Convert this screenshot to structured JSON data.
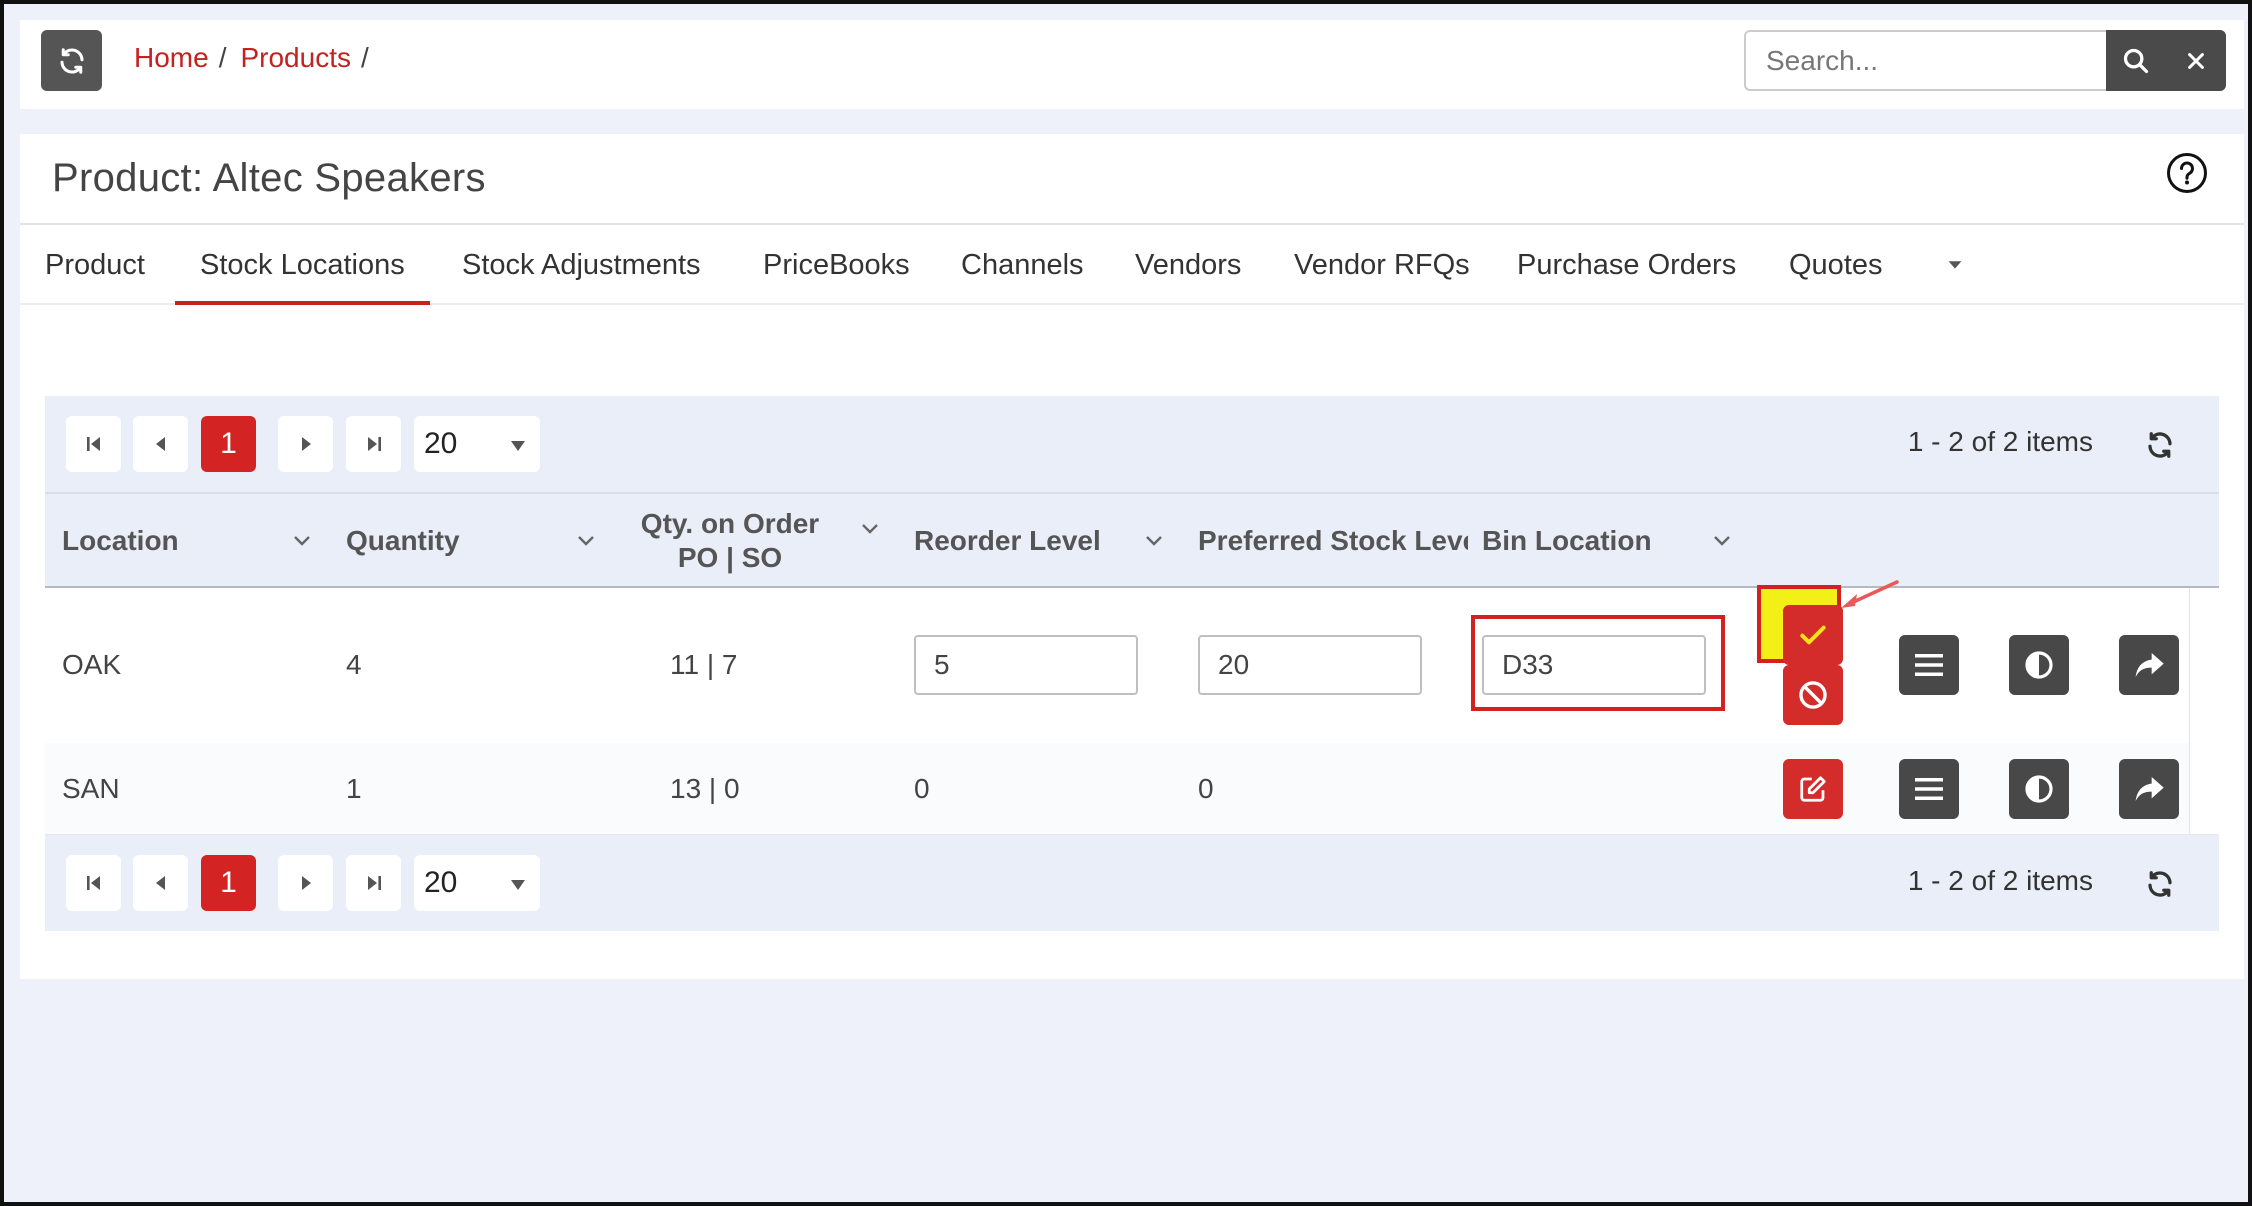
{
  "topbar": {
    "breadcrumb": {
      "home": "Home",
      "products": "Products",
      "sep1": "/",
      "sep2": "/"
    },
    "search": {
      "placeholder": "Search...",
      "value": ""
    }
  },
  "page": {
    "title": "Product: Altec Speakers"
  },
  "tabs": [
    {
      "label": "Product",
      "active": false
    },
    {
      "label": "Stock Locations",
      "active": true
    },
    {
      "label": "Stock Adjustments",
      "active": false
    },
    {
      "label": "PriceBooks",
      "active": false
    },
    {
      "label": "Channels",
      "active": false
    },
    {
      "label": "Vendors",
      "active": false
    },
    {
      "label": "Vendor RFQs",
      "active": false
    },
    {
      "label": "Purchase Orders",
      "active": false
    },
    {
      "label": "Quotes",
      "active": false
    }
  ],
  "pager": {
    "current_page": "1",
    "page_size": "20",
    "info": "1 - 2 of 2 items"
  },
  "grid": {
    "columns": {
      "location": "Location",
      "quantity": "Quantity",
      "qty_on_order_line1": "Qty. on Order",
      "qty_on_order_line2": "PO | SO",
      "reorder_level": "Reorder Level",
      "preferred_stock_level": "Preferred Stock Leve",
      "bin_location": "Bin Location"
    },
    "rows": [
      {
        "location": "OAK",
        "quantity": "4",
        "qty_on_order": "11 | 7",
        "reorder_level": "5",
        "preferred_stock_level": "20",
        "bin_location": "D33",
        "editing": true
      },
      {
        "location": "SAN",
        "quantity": "1",
        "qty_on_order": "13 | 0",
        "reorder_level": "0",
        "preferred_stock_level": "0",
        "bin_location": "",
        "editing": false
      }
    ]
  },
  "colors": {
    "accent": "#c42121",
    "highlight": "#f3f018",
    "dark_button": "#484848",
    "grid_bg": "#e9eef8"
  }
}
